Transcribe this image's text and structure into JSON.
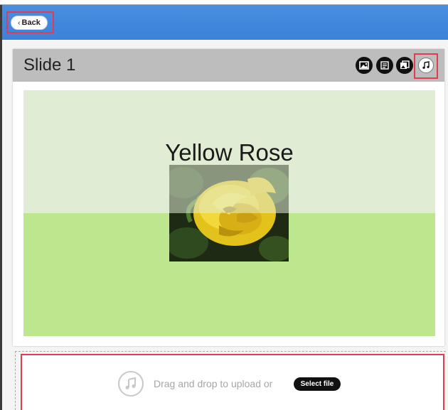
{
  "topbar": {
    "back_label": "Back"
  },
  "slide": {
    "title": "Slide 1",
    "heading": "Yellow Rose",
    "toolbar_icons": [
      "image-icon",
      "text-layout-icon",
      "photo-add-icon",
      "music-note-icon"
    ]
  },
  "upload": {
    "prompt": "Drag and drop to upload or",
    "select_label": "Select file"
  },
  "colors": {
    "topbar": "#3f86dc",
    "highlight": "#e33b4f",
    "slide_top": "#e1ecd5",
    "slide_bottom": "#bde78e",
    "header": "#bdbdbd"
  }
}
